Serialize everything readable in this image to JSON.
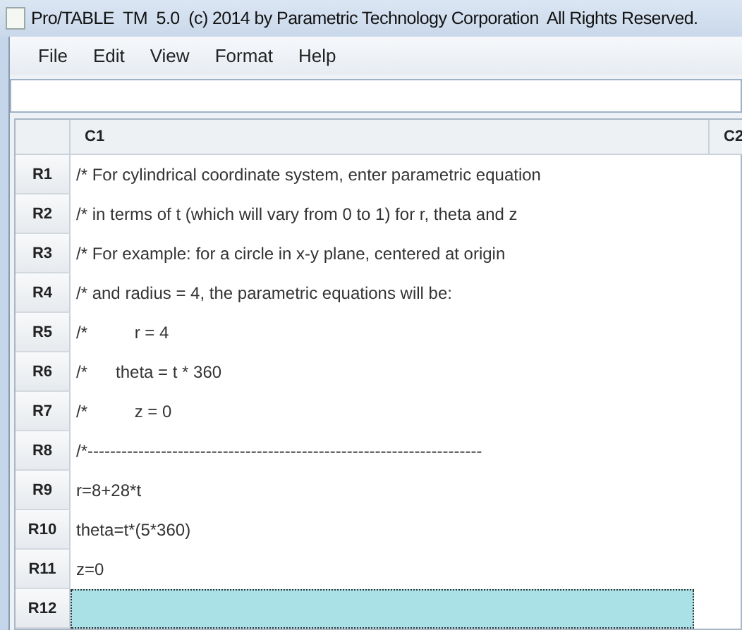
{
  "window": {
    "title": "Pro/TABLE  TM  5.0  (c) 2014 by Parametric Technology Corporation  All Rights Reserved."
  },
  "menu": [
    "File",
    "Edit",
    "View",
    "Format",
    "Help"
  ],
  "table": {
    "columns": [
      "C1",
      "C2"
    ],
    "rows": [
      {
        "header": "R1",
        "cells": [
          "/* For cylindrical coordinate system, enter parametric equation"
        ],
        "selected": false
      },
      {
        "header": "R2",
        "cells": [
          "/* in terms of t (which will vary from 0 to 1) for r, theta and z"
        ],
        "selected": false
      },
      {
        "header": "R3",
        "cells": [
          "/* For example: for a circle in x-y plane, centered at origin"
        ],
        "selected": false
      },
      {
        "header": "R4",
        "cells": [
          "/* and radius = 4, the parametric equations will be:"
        ],
        "selected": false
      },
      {
        "header": "R5",
        "cells": [
          "/*          r = 4"
        ],
        "selected": false
      },
      {
        "header": "R6",
        "cells": [
          "/*      theta = t * 360"
        ],
        "selected": false
      },
      {
        "header": "R7",
        "cells": [
          "/*          z = 0"
        ],
        "selected": false
      },
      {
        "header": "R8",
        "cells": [
          "/*----------------------------------------------------------------------"
        ],
        "selected": false
      },
      {
        "header": "R9",
        "cells": [
          "r=8+28*t"
        ],
        "selected": false
      },
      {
        "header": "R10",
        "cells": [
          "theta=t*(5*360)"
        ],
        "selected": false
      },
      {
        "header": "R11",
        "cells": [
          "z=0"
        ],
        "selected": false
      },
      {
        "header": "R12",
        "cells": [],
        "selected": true
      }
    ]
  }
}
